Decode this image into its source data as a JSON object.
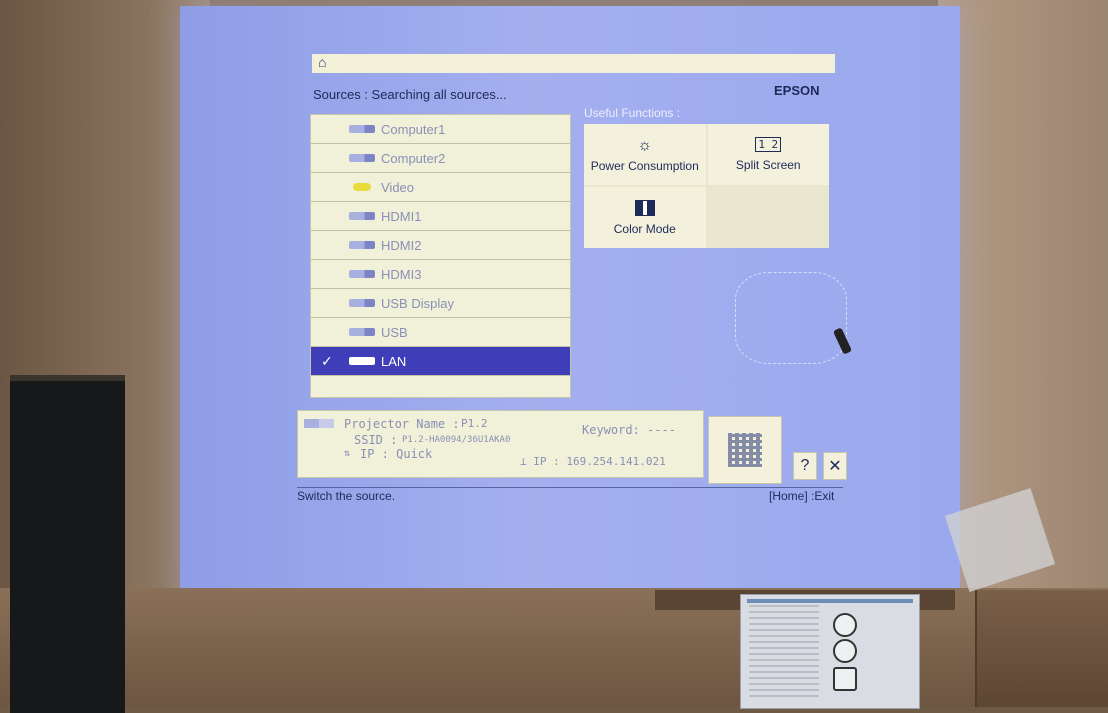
{
  "header": {
    "home_icon": "home-icon",
    "sources_title": "Sources : Searching all sources...",
    "brand": "EPSON",
    "useful_functions_title": "Useful Functions :"
  },
  "sources": [
    {
      "label": "Computer1",
      "icon": "computer-connector-icon",
      "selected": false
    },
    {
      "label": "Computer2",
      "icon": "computer-connector-icon",
      "selected": false
    },
    {
      "label": "Video",
      "icon": "video-connector-icon",
      "selected": false
    },
    {
      "label": "HDMI1",
      "icon": "hdmi-connector-icon",
      "selected": false
    },
    {
      "label": "HDMI2",
      "icon": "hdmi-connector-icon",
      "selected": false
    },
    {
      "label": "HDMI3",
      "icon": "hdmi-connector-icon",
      "selected": false
    },
    {
      "label": "USB Display",
      "icon": "usb-connector-icon",
      "selected": false
    },
    {
      "label": "USB",
      "icon": "usb-connector-icon",
      "selected": false
    },
    {
      "label": "LAN",
      "icon": "lan-connector-icon",
      "selected": true
    }
  ],
  "functions": {
    "power_consumption": "Power Consumption",
    "split_screen": "Split Screen",
    "split_screen_icon_text": "1 2",
    "color_mode": "Color Mode"
  },
  "info": {
    "projector_name_label": "Projector Name :",
    "projector_name_value": "P1.2",
    "keyword": "Keyword: ----",
    "ssid_label": "SSID :",
    "ssid_value": "P1.2-HA0094/36U1AKA0",
    "ip_mode": "IP : Quick",
    "ip_address": "⊥ IP : 169.254.141.021"
  },
  "controls": {
    "help": "?",
    "close": "✕"
  },
  "footer": {
    "status": "Switch the source.",
    "exit_hint": "[Home] :Exit"
  },
  "colors": {
    "screen_background": "#9aa8ee",
    "panel": "#f1f0d8",
    "selected": "#3f3db8",
    "text_dark": "#1d2a5a"
  }
}
